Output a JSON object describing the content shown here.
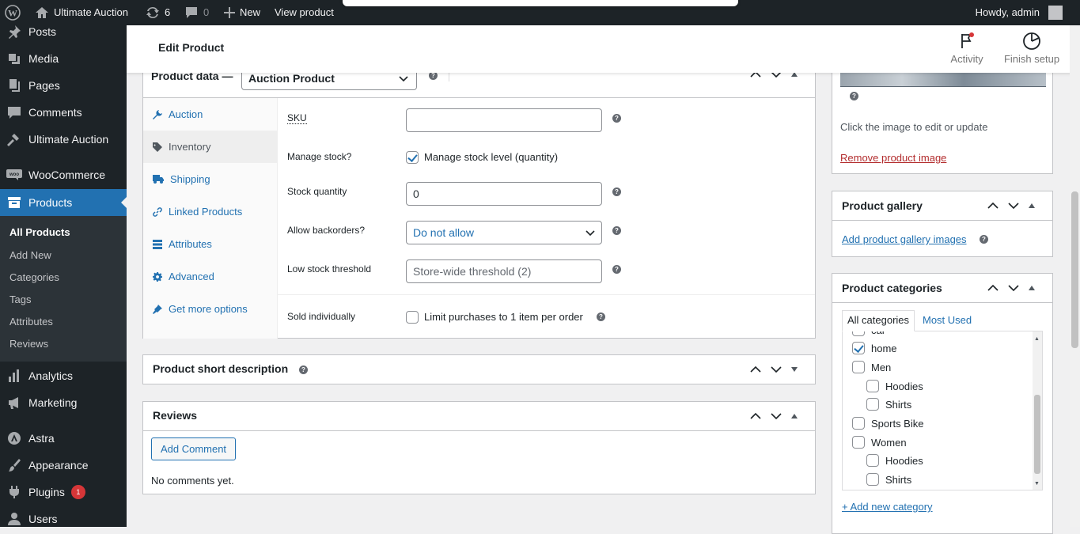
{
  "admin_bar": {
    "site_name": "Ultimate Auction",
    "updates_count": "6",
    "comments_count": "0",
    "new_label": "New",
    "view_label": "View product",
    "greeting": "Howdy, admin"
  },
  "admin_menu": {
    "items": [
      {
        "label": "Posts",
        "icon": "pushpin-icon"
      },
      {
        "label": "Media",
        "icon": "media-icon"
      },
      {
        "label": "Pages",
        "icon": "pages-icon"
      },
      {
        "label": "Comments",
        "icon": "comments-icon"
      },
      {
        "label": "Ultimate Auction",
        "icon": "hammer-icon"
      },
      {
        "label": "WooCommerce",
        "icon": "woocommerce-icon"
      },
      {
        "label": "Products",
        "icon": "archive-icon"
      },
      {
        "label": "Analytics",
        "icon": "chart-bar-icon"
      },
      {
        "label": "Marketing",
        "icon": "megaphone-icon"
      },
      {
        "label": "Astra",
        "icon": "astra-icon"
      },
      {
        "label": "Appearance",
        "icon": "paintbrush-icon"
      },
      {
        "label": "Plugins",
        "icon": "plugin-icon",
        "badge": "1"
      },
      {
        "label": "Users",
        "icon": "users-icon"
      }
    ],
    "submenu": [
      "All Products",
      "Add New",
      "Categories",
      "Tags",
      "Attributes",
      "Reviews"
    ]
  },
  "header": {
    "title": "Edit Product",
    "activity_label": "Activity",
    "finish_setup_label": "Finish setup"
  },
  "product_data": {
    "title": "Product data —",
    "type_value": "Auction Product",
    "tabs": [
      "Auction",
      "Inventory",
      "Shipping",
      "Linked Products",
      "Attributes",
      "Advanced",
      "Get more options"
    ],
    "sku_label": "SKU",
    "sku_value": "",
    "manage_stock_label": "Manage stock?",
    "manage_stock_checkbox_label": "Manage stock level (quantity)",
    "stock_quantity_label": "Stock quantity",
    "stock_quantity_value": "0",
    "backorders_label": "Allow backorders?",
    "backorders_value": "Do not allow",
    "low_stock_label": "Low stock threshold",
    "low_stock_placeholder": "Store-wide threshold (2)",
    "sold_individually_label": "Sold individually",
    "sold_individually_checkbox_label": "Limit purchases to 1 item per order"
  },
  "short_description": {
    "title": "Product short description"
  },
  "reviews": {
    "title": "Reviews",
    "add_comment_label": "Add Comment",
    "empty_text": "No comments yet."
  },
  "product_image": {
    "edit_hint": "Click the image to edit or update",
    "remove_label": "Remove product image"
  },
  "product_gallery": {
    "title": "Product gallery",
    "add_label": "Add product gallery images"
  },
  "product_categories": {
    "title": "Product categories",
    "tab_all": "All categories",
    "tab_most_used": "Most Used",
    "partial_top": "car",
    "items": [
      {
        "label": "home",
        "checked": true,
        "child": false
      },
      {
        "label": "Men",
        "checked": false,
        "child": false
      },
      {
        "label": "Hoodies",
        "checked": false,
        "child": true
      },
      {
        "label": "Shirts",
        "checked": false,
        "child": true
      },
      {
        "label": "Sports Bike",
        "checked": false,
        "child": false
      },
      {
        "label": "Women",
        "checked": false,
        "child": false
      },
      {
        "label": "Hoodies",
        "checked": false,
        "child": true
      },
      {
        "label": "Shirts",
        "checked": false,
        "child": true
      }
    ],
    "add_new_label": "+ Add new category"
  },
  "colors": {
    "admin_dark": "#1d2327",
    "accent_blue": "#2271b1",
    "danger_red": "#d63638"
  }
}
